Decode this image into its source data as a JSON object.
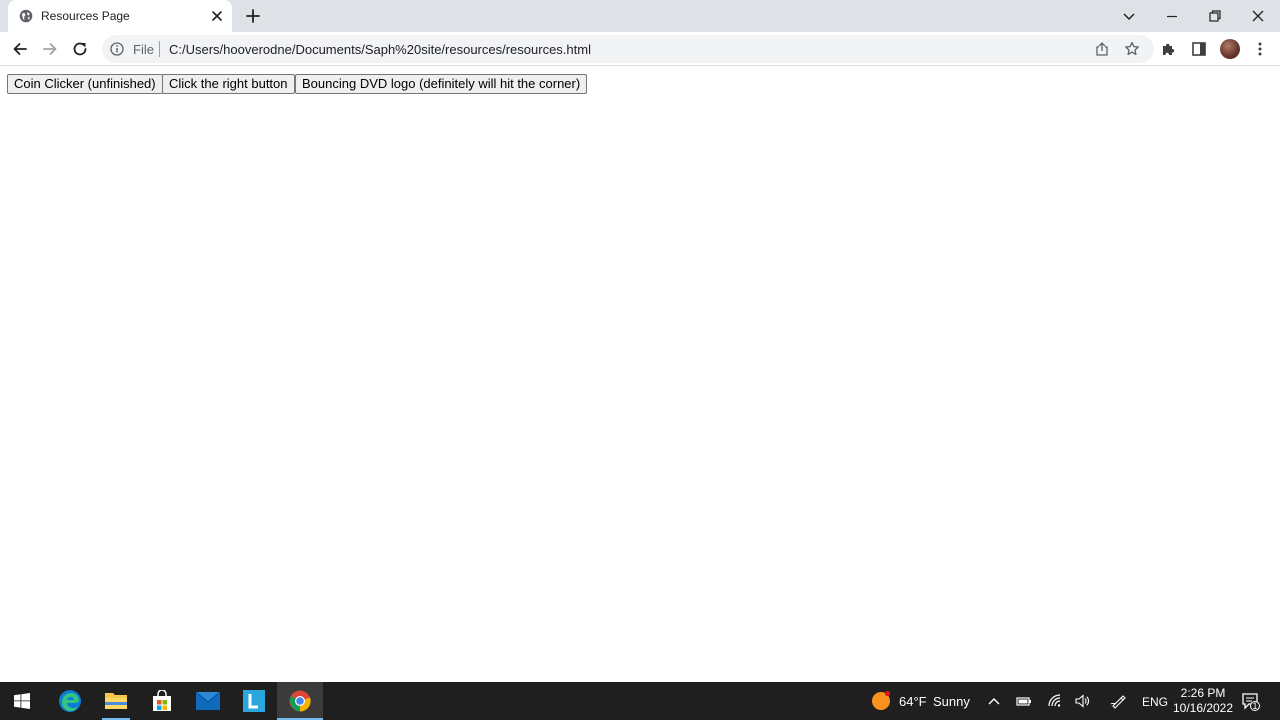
{
  "browser": {
    "tab_title": "Resources Page",
    "omnibox_scheme_label": "File",
    "url": "C:/Users/hooverodne/Documents/Saph%20site/resources/resources.html"
  },
  "page": {
    "buttons": [
      {
        "label": "Coin Clicker (unfinished)"
      },
      {
        "label": "Click the right button"
      },
      {
        "label": "Bouncing DVD logo (definitely will hit the corner)"
      }
    ]
  },
  "taskbar": {
    "weather": {
      "temperature": "64°F",
      "condition": "Sunny"
    },
    "language": "ENG",
    "time": "2:26 PM",
    "date": "10/16/2022",
    "notification_count": "1"
  },
  "colors": {
    "tabstrip_bg": "#dee1e6",
    "taskbar_bg": "#1f1f1f",
    "taskbar_accent": "#76b9ed"
  }
}
